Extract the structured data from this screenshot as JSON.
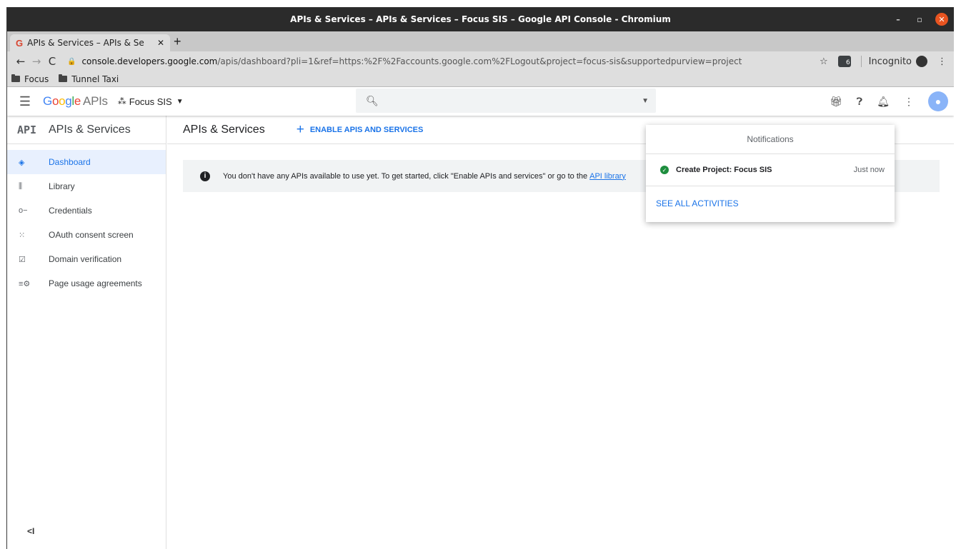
{
  "window": {
    "title": "APIs & Services – APIs & Services – Focus SIS – Google API Console - Chromium",
    "minimize": "–",
    "maximize": "▫",
    "close": "✕"
  },
  "tab": {
    "favicon": "G",
    "title": "APIs & Services – APIs & Se",
    "close": "✕",
    "new_tab": "+"
  },
  "nav": {
    "back": "←",
    "forward": "→",
    "reload": "C",
    "url_host": "console.developers.google.com",
    "url_path": "/apis/dashboard?pli=1&ref=https:%2F%2Faccounts.google.com%2FLogout&project=focus-sis&supportedpurview=project",
    "star": "☆",
    "extension_badge": "6",
    "incognito_label": "Incognito",
    "menu": "⋮"
  },
  "bookmarks": [
    {
      "label": "Focus"
    },
    {
      "label": "Tunnel Taxi"
    }
  ],
  "gheader": {
    "logo_google": "Google",
    "logo_apis": "APIs",
    "project_name": "Focus SIS",
    "search_placeholder": "",
    "colors": {
      "blue": "#4285F4",
      "red": "#EA4335",
      "yellow": "#FBBC05",
      "green": "#34A853"
    }
  },
  "sidebar": {
    "api_label": "API",
    "title": "APIs & Services",
    "items": [
      {
        "label": "Dashboard",
        "icon": "dashboard-icon",
        "active": true
      },
      {
        "label": "Library",
        "icon": "library-icon"
      },
      {
        "label": "Credentials",
        "icon": "key-icon"
      },
      {
        "label": "OAuth consent screen",
        "icon": "oauth-icon"
      },
      {
        "label": "Domain verification",
        "icon": "checkbox-icon"
      },
      {
        "label": "Page usage agreements",
        "icon": "settings-list-icon"
      }
    ],
    "collapse": "<I"
  },
  "main": {
    "title": "APIs & Services",
    "enable_button": "ENABLE APIS AND SERVICES",
    "info_text": "You don't have any APIs available to use yet. To get started, click \"Enable APIs and services\" or go to the",
    "info_link": "API library"
  },
  "notifications": {
    "title": "Notifications",
    "items": [
      {
        "text": "Create Project: Focus SIS",
        "time": "Just now",
        "status": "success"
      }
    ],
    "see_all": "SEE ALL ACTIVITIES"
  }
}
